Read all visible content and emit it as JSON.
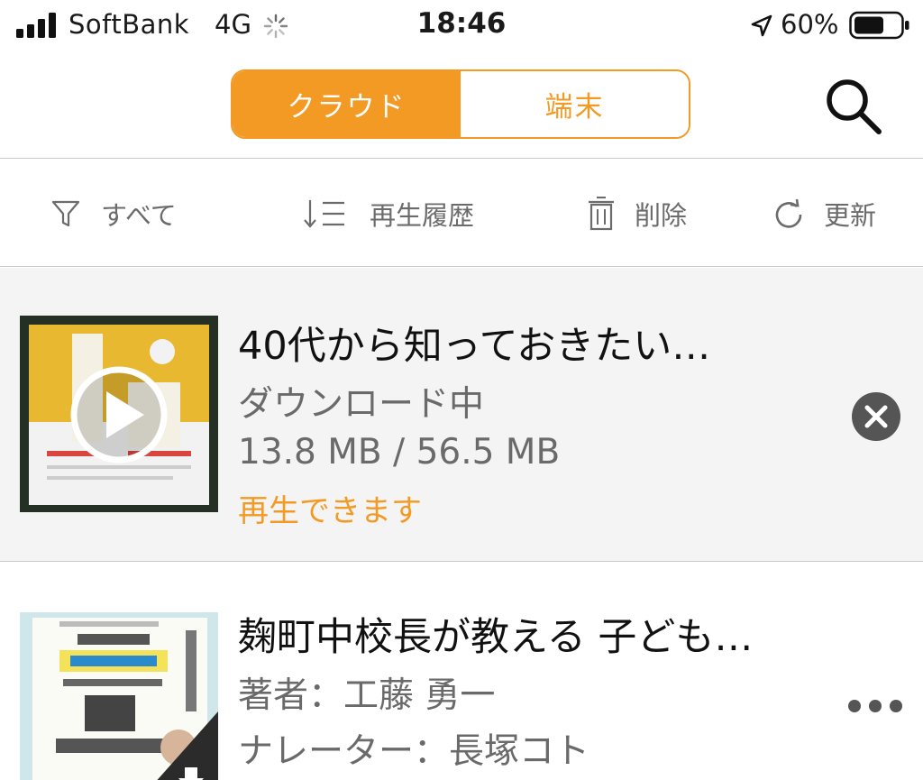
{
  "status_bar": {
    "carrier": "SoftBank",
    "network": "4G",
    "time": "18:46",
    "battery_percent": "60%",
    "icons": [
      "signal-bars-icon",
      "loading-spinner-icon",
      "location-arrow-icon",
      "battery-icon"
    ]
  },
  "nav": {
    "segments": [
      {
        "label": "クラウド",
        "selected": true
      },
      {
        "label": "端末",
        "selected": false
      }
    ],
    "search_icon": "search-icon"
  },
  "toolbar": {
    "items": [
      {
        "label": "すべて",
        "icon": "filter-icon"
      },
      {
        "label": "再生履歴",
        "icon": "sort-icon"
      },
      {
        "label": "削除",
        "icon": "trash-icon"
      },
      {
        "label": "更新",
        "icon": "refresh-icon"
      }
    ]
  },
  "list": {
    "items": [
      {
        "title": "40代から知っておきたい…",
        "status": "ダウンロード中",
        "progress": "13.8 MB / 56.5 MB",
        "downloaded_mb": 13.8,
        "total_mb": 56.5,
        "note": "再生できます",
        "action_icon": "cancel-download-icon",
        "cover_icon": "play-icon"
      },
      {
        "title": "麹町中校長が教える 子ども…",
        "author": "著者：工藤 勇一",
        "narrator": "ナレーター：長塚コト",
        "action_icon": "more-icon",
        "cover_icon": "download-badge-icon"
      }
    ]
  },
  "colors": {
    "accent": "#f39a24",
    "separator": "#c9c9c9",
    "row_highlight": "#f4f4f4",
    "secondary_text": "#6a6a6a"
  }
}
